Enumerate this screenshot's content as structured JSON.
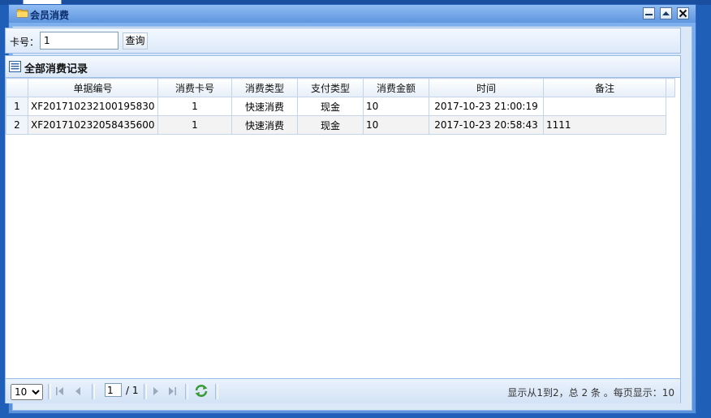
{
  "window": {
    "title": "会员消费"
  },
  "search": {
    "label": "卡号：",
    "value": "1",
    "button_label": "查询"
  },
  "grid": {
    "title": "全部消费记录",
    "columns": [
      "单据编号",
      "消费卡号",
      "消费类型",
      "支付类型",
      "消费金额",
      "时间",
      "备注"
    ],
    "rows": [
      {
        "num": "1",
        "cells": [
          "XF201710232100195830",
          "1",
          "快速消费",
          "现金",
          "10",
          "2017-10-23 21:00:19",
          ""
        ]
      },
      {
        "num": "2",
        "cells": [
          "XF201710232058435600",
          "1",
          "快速消费",
          "现金",
          "10",
          "2017-10-23 20:58:43",
          "1111"
        ]
      }
    ]
  },
  "pager": {
    "page_size": "10",
    "page_size_options": [
      "10"
    ],
    "current_page": "1",
    "total_pages": "/ 1",
    "info": "显示从1到2，总 2 条 。每页显示：10"
  },
  "icons": {
    "folder": "folder-icon",
    "list": "list-icon",
    "minimize": "minimize-icon",
    "maximize": "maximize-icon",
    "close": "close-icon",
    "first": "first-page-icon",
    "prev": "prev-page-icon",
    "next": "next-page-icon",
    "last": "last-page-icon",
    "refresh": "refresh-icon"
  },
  "colors": {
    "window_title": "#0b2f6e",
    "frame": "#5a92dc",
    "border": "#99bbe8"
  }
}
